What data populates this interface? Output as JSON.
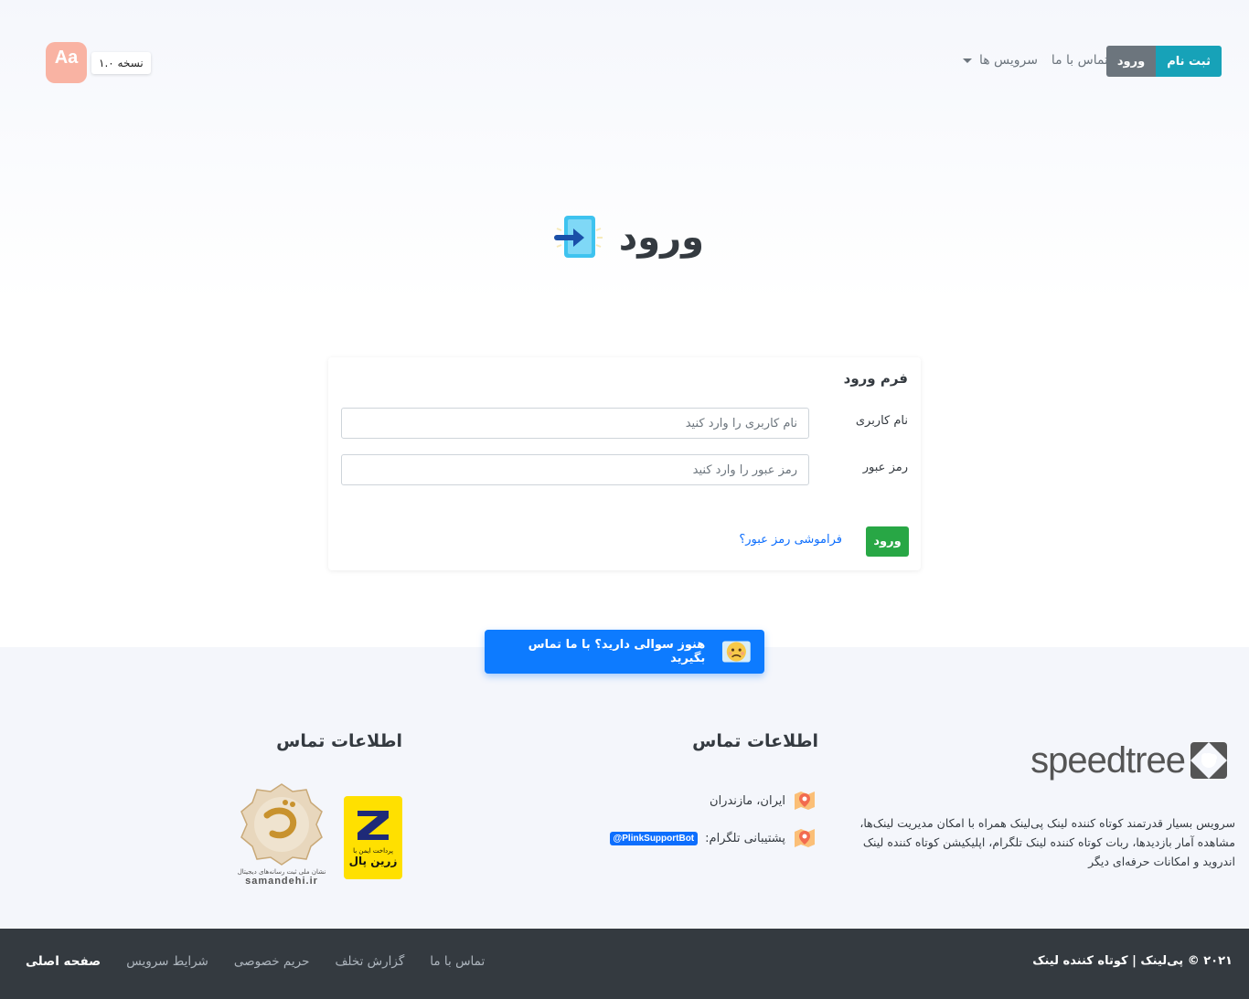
{
  "navbar": {
    "register_label": "ثبت نام",
    "login_label": "ورود",
    "contact_label": "تماس با ما",
    "services_label": "سرویس ها",
    "version_label": "نسخه ۱.۰",
    "font_toggle_label": "Aa"
  },
  "hero": {
    "title": "ورود"
  },
  "login_form": {
    "title": "فرم ورود",
    "username_label": "نام کاربری",
    "username_placeholder": "نام کاربری را وارد کنید",
    "password_label": "رمز عبور",
    "password_placeholder": "رمز عبور را وارد کنید",
    "submit_label": "ورود",
    "forgot_label": "فراموشی رمز عبور؟"
  },
  "cta": {
    "label": "هنوز سوالی دارید؟ با ما تماس بگیرید"
  },
  "footer": {
    "brand_name": "speedtree",
    "brand_description": "سرویس بسیار قدرتمند کوتاه کننده لینک پی‌لینک همراه با امکان مدیریت لینک‌ها، مشاهده آمار بازدیدها، ربات کوتاه کننده لینک تلگرام، اپلیکیشن کوتاه کننده لینک اندروید و امکانات حرفه‌ای دیگر",
    "contact_heading": "اطلاعات تماس",
    "trust_heading": "اطلاعات تماس",
    "location": "ایران، مازندران",
    "telegram_support_label": "پشتیبانی تلگرام:",
    "telegram_bot": "@PlinkSupportBot",
    "zarinpal_caption": "پرداخت ایمن با",
    "zarinpal_name": "زرین پال",
    "samandehi_caption": "نشان ملی ثبت رسانه‌های دیجیتال",
    "samandehi_url": "samandehi.ir"
  },
  "bottom_bar": {
    "copyright": "۲۰۲۱ © پی‌لینک | کوتاه کننده لینک",
    "links": [
      "صفحه اصلی",
      "شرایط سرویس",
      "حریم خصوصی",
      "گزارش تخلف",
      "تماس با ما"
    ]
  },
  "colors": {
    "register_button": "#17a2b8",
    "login_button": "#6c757d",
    "submit_button": "#28a745",
    "cta_button": "#0d7bff",
    "footer_bar": "#343a40",
    "zarinpal_yellow": "#ffe000"
  },
  "icons": {
    "hero": "login-arrow-icon",
    "cta": "worried-face-icon",
    "location": "map-pin-icon"
  }
}
